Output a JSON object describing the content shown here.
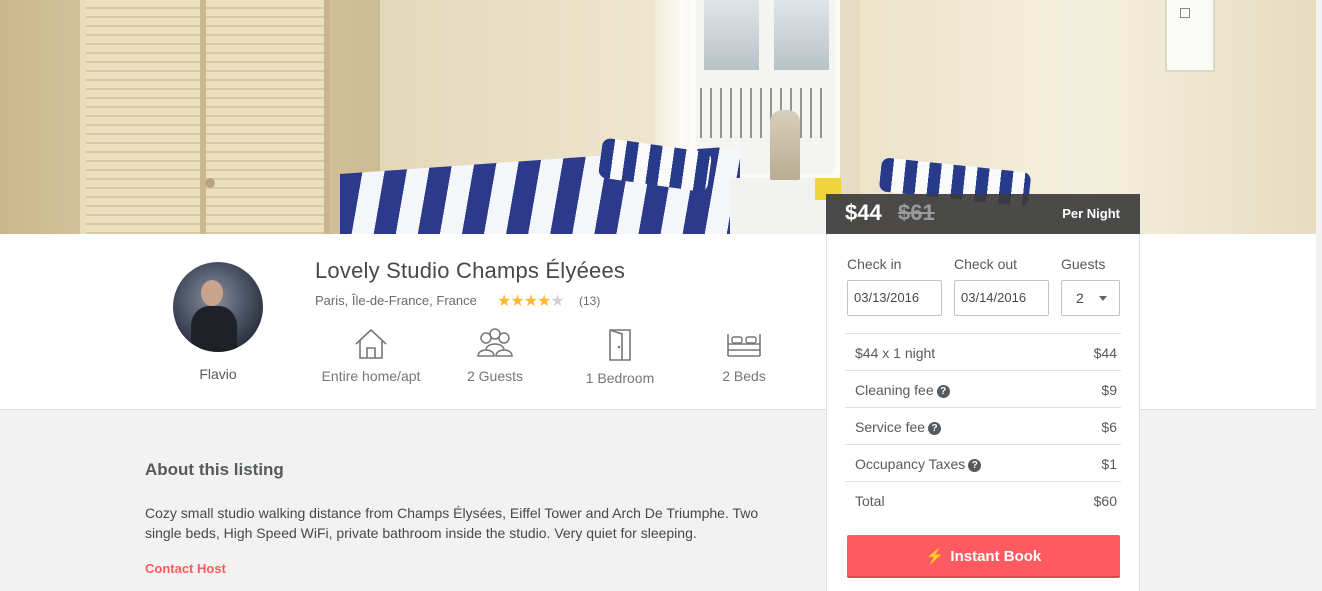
{
  "listing": {
    "title": "Lovely Studio Champs Élyéees",
    "location": "Paris, Île-de-France, France",
    "rating": 4,
    "rating_max": 5,
    "review_count": "(13)"
  },
  "host": {
    "name": "Flavio"
  },
  "amenities": [
    {
      "icon": "house-icon",
      "label": "Entire home/apt"
    },
    {
      "icon": "guests-icon",
      "label": "2 Guests"
    },
    {
      "icon": "door-icon",
      "label": "1 Bedroom"
    },
    {
      "icon": "bed-icon",
      "label": "2 Beds"
    }
  ],
  "about": {
    "title": "About this listing",
    "text": "Cozy small studio walking distance from Champs Élysées, Eiffel Tower and Arch De Triumphe. Two single beds, High Speed WiFi, private bathroom inside the studio. Very quiet for sleeping.",
    "contact_label": "Contact Host"
  },
  "booking": {
    "price": "$44",
    "old_price": "$61",
    "per_night": "Per Night",
    "checkin_label": "Check in",
    "checkout_label": "Check out",
    "guests_label": "Guests",
    "checkin_value": "03/13/2016",
    "checkout_value": "03/14/2016",
    "guests_value": "2",
    "breakdown": [
      {
        "label": "$44 x 1 night",
        "value": "$44"
      },
      {
        "label": "Cleaning fee",
        "value": "$9"
      },
      {
        "label": "Service fee",
        "value": "$6"
      },
      {
        "label": "Occupancy Taxes",
        "value": "$1"
      },
      {
        "label": "Total",
        "value": "$60"
      }
    ],
    "help_glyph": "?",
    "book_label": "Instant Book",
    "bolt_glyph": "⚡"
  },
  "colors": {
    "accent": "#ff5a5f",
    "star": "#fcb833",
    "text": "#484848",
    "price_bar": "#3c3c3c"
  }
}
